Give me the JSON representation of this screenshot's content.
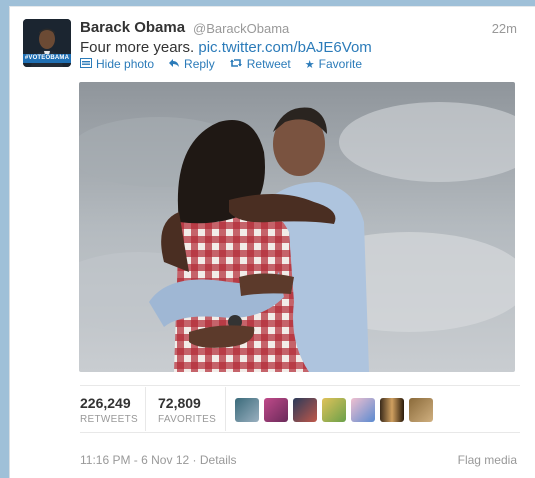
{
  "tweet": {
    "name": "Barack Obama",
    "handle": "@BarackObama",
    "time_ago": "22m",
    "text": "Four more years.",
    "link": "pic.twitter.com/bAJE6Vom",
    "avatar_band": "#VOTEOBAMA"
  },
  "actions": [
    {
      "label": "Hide photo",
      "icon": "photo-icon"
    },
    {
      "label": "Reply",
      "icon": "reply-icon"
    },
    {
      "label": "Retweet",
      "icon": "retweet-icon"
    },
    {
      "label": "Favorite",
      "icon": "star-icon"
    }
  ],
  "stats": {
    "retweets": "226,249",
    "retweets_label": "RETWEETS",
    "favorites": "72,809",
    "favorites_label": "FAVORITES"
  },
  "footer": {
    "timestamp": "11:16 PM - 6 Nov 12",
    "separator": "·",
    "details": "Details",
    "flag": "Flag media"
  },
  "colors": {
    "link": "#2b7bb9",
    "muted": "#999999",
    "background": "#9fc0d8"
  }
}
